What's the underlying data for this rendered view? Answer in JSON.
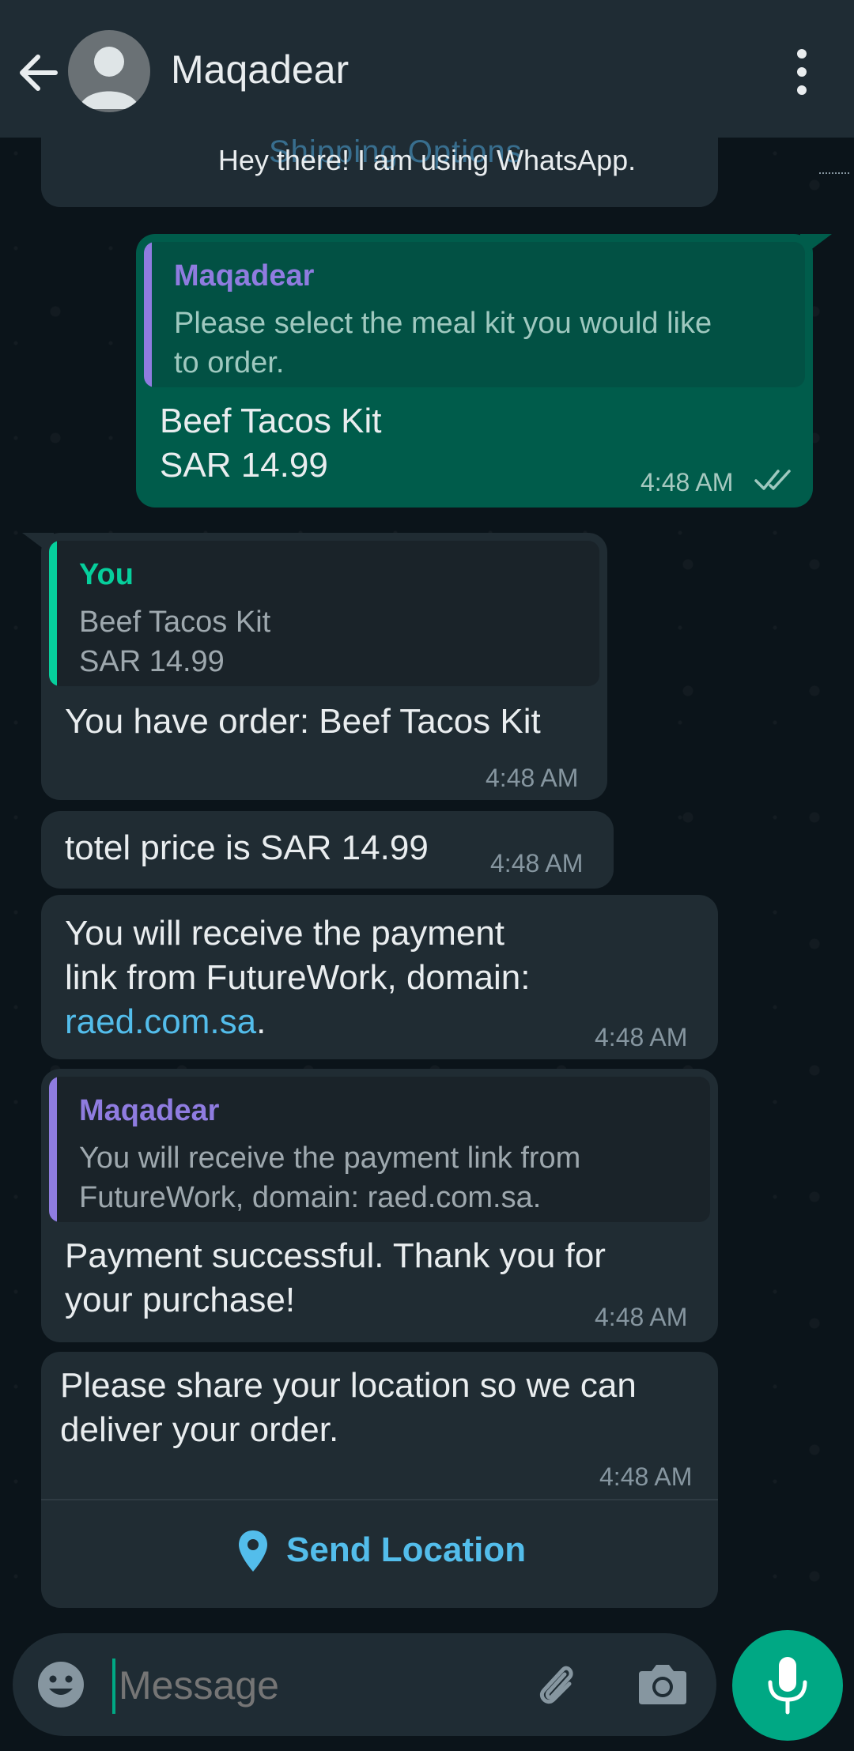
{
  "header": {
    "contact_name": "Maqadear",
    "icons": [
      "back-arrow-icon",
      "avatar-placeholder-icon",
      "more-vertical-icon"
    ]
  },
  "status": {
    "text": "Hey there! I am using WhatsApp.",
    "overlapped_text": "Shipping Options"
  },
  "messages": [
    {
      "direction": "outgoing",
      "quote_name": "Maqadear",
      "quote_lines": [
        "Please select the meal kit you would like",
        "to order."
      ],
      "body_lines": [
        "Beef Tacos Kit",
        "SAR 14.99"
      ],
      "time": "4:48 AM"
    },
    {
      "direction": "incoming",
      "quote_name": "You",
      "quote_lines": [
        "Beef Tacos Kit",
        "SAR 14.99"
      ],
      "body_lines": [
        "You have order:  Beef Tacos Kit"
      ],
      "time": "4:48 AM"
    },
    {
      "direction": "incoming",
      "body_lines": [
        "totel price is SAR 14.99"
      ],
      "time": "4:48 AM"
    },
    {
      "direction": "incoming",
      "body_lines": [
        "You will receive the payment",
        "link from FutureWork, domain:"
      ],
      "link_text": "raed.com.sa",
      "link_suffix": ".",
      "time": "4:48 AM"
    },
    {
      "direction": "incoming",
      "quote_name": "Maqadear",
      "quote_lines": [
        "You will receive the payment link from",
        "FutureWork, domain: raed.com.sa."
      ],
      "body_lines": [
        "Payment successful. Thank you for",
        "your purchase!"
      ],
      "time": "4:48 AM"
    },
    {
      "direction": "incoming",
      "body_lines": [
        "Please share your location so we can",
        "deliver your order."
      ],
      "time": "4:48 AM",
      "action_label": "Send Location"
    }
  ],
  "input": {
    "placeholder": "Message"
  },
  "colors": {
    "header_bg": "#1f2c34",
    "chat_bg": "#0b141a",
    "incoming_bubble": "#202c33",
    "outgoing_bubble": "#005c4b",
    "accent_green": "#00a884",
    "link_blue": "#53bdeb",
    "quote_purple": "#8f7ce0",
    "quote_green": "#06cf9c"
  }
}
